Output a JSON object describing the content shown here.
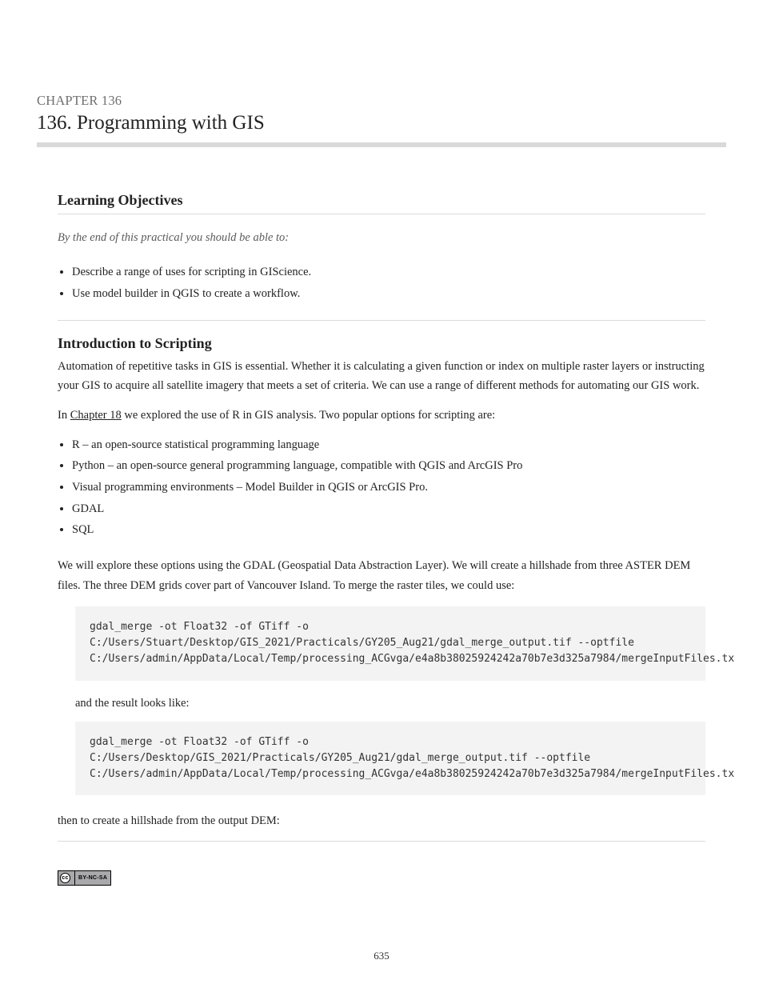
{
  "kicker": "CHAPTER 136",
  "title": "136. Programming with GIS",
  "section1": {
    "heading": "Learning Objectives",
    "lead": "By the end of this practical you should be able to:",
    "bullets": [
      "Describe a range of uses for scripting in GIScience.",
      "Use model builder in QGIS to create a workflow."
    ]
  },
  "section2": {
    "heading": "Introduction to Scripting",
    "para1": "Automation of repetitive tasks in GIS is essential. Whether it is calculating a given function or index on multiple raster layers or instructing your GIS to acquire all satellite imagery that meets a set of criteria. We can use a range of different methods for automating our GIS work.",
    "para2_prefix": "In ",
    "para2_link": "Chapter 18",
    "para2_suffix": " we explored the use of R in GIS analysis. Two popular options for scripting are:",
    "options": [
      "R – an open-source statistical programming language",
      "Python – an open-source general programming language, compatible with QGIS and ArcGIS Pro",
      "Visual programming environments – Model Builder in QGIS or ArcGIS Pro.",
      "GDAL",
      "SQL"
    ],
    "para3": "We will explore these options using the GDAL (Geospatial Data Abstraction Layer). We will create a hillshade from three ASTER DEM files. The three DEM grids cover part of Vancouver Island. To merge the raster tiles, we could use:",
    "code1": "gdal_merge -ot Float32 -of GTiff -o \nC:/Users/Stuart/Desktop/GIS_2021/Practicals/GY205_Aug21/gdal_merge_output.tif --optfile \nC:/Users/admin/AppData/Local/Temp/processing_ACGvga/e4a8b38025924242a70b7e3d325a7984/mergeInputFiles.tx",
    "result_label": "and the result looks like:",
    "code2": "gdal_merge -ot Float32 -of GTiff -o \nC:/Users/Desktop/GIS_2021/Practicals/GY205_Aug21/gdal_merge_output.tif --optfile \nC:/Users/admin/AppData/Local/Temp/processing_ACGvga/e4a8b38025924242a70b7e3d325a7984/mergeInputFiles.tx",
    "para4": "then to create a hillshade from the output DEM:"
  },
  "cc_badge": {
    "left": "cc",
    "right": "BY-NC-SA"
  },
  "page_number": "635"
}
